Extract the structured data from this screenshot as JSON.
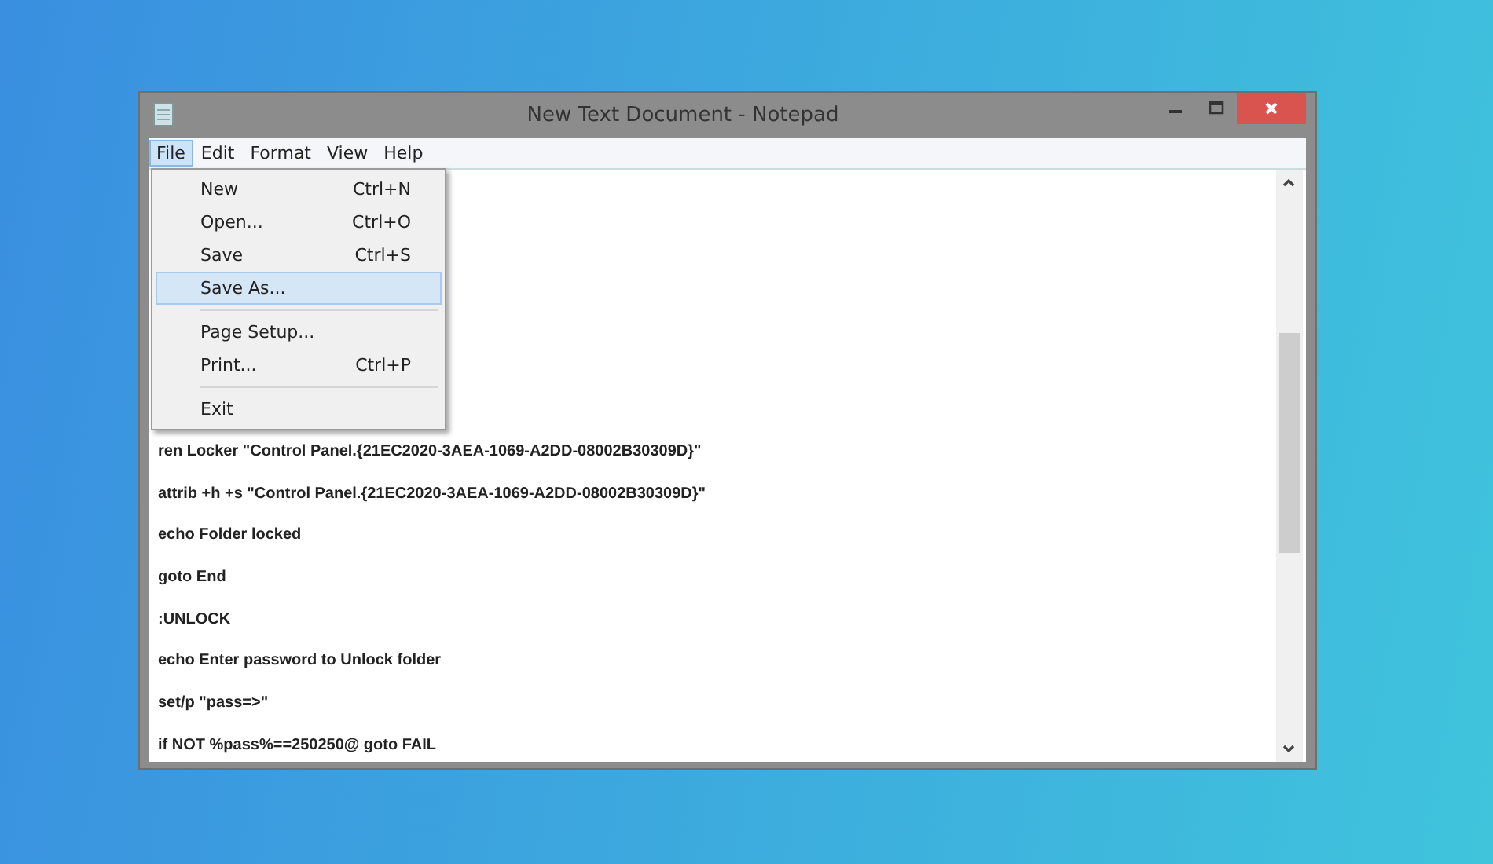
{
  "window": {
    "title": "New Text Document - Notepad"
  },
  "menu_bar": [
    {
      "label": "File",
      "selected": true
    },
    {
      "label": "Edit",
      "selected": false
    },
    {
      "label": "Format",
      "selected": false
    },
    {
      "label": "View",
      "selected": false
    },
    {
      "label": "Help",
      "selected": false
    }
  ],
  "file_menu": [
    {
      "kind": "item",
      "label": "New",
      "shortcut": "Ctrl+N",
      "selected": false
    },
    {
      "kind": "item",
      "label": "Open...",
      "shortcut": "Ctrl+O",
      "selected": false
    },
    {
      "kind": "item",
      "label": "Save",
      "shortcut": "Ctrl+S",
      "selected": false
    },
    {
      "kind": "item",
      "label": "Save As...",
      "selected": true
    },
    {
      "kind": "separator"
    },
    {
      "kind": "item",
      "label": "Page Setup...",
      "selected": false
    },
    {
      "kind": "item",
      "label": "Print...",
      "shortcut": "Ctrl+P",
      "selected": false
    },
    {
      "kind": "separator"
    },
    {
      "kind": "item",
      "label": "Exit",
      "selected": false
    }
  ],
  "document_lines": [
    "ren Locker \"Control Panel.{21EC2020-3AEA-1069-A2DD-08002B30309D}\"",
    "attrib +h +s \"Control Panel.{21EC2020-3AEA-1069-A2DD-08002B30309D}\"",
    "echo Folder locked",
    "goto End",
    ":UNLOCK",
    "echo Enter password to Unlock folder",
    "set/p \"pass=>\"",
    "if NOT %pass%==250250@ goto FAIL"
  ]
}
